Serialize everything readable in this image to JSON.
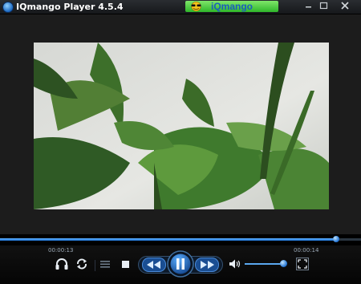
{
  "window": {
    "title": "IQmango Player 4.5.4",
    "brand_label": "iQmango"
  },
  "player": {
    "elapsed": "00:00:13",
    "total": "00:00:14",
    "progress_fraction": 0.93,
    "volume_fraction": 0.95
  },
  "icons": {
    "app": "app-logo-icon",
    "minimize": "minimize-icon",
    "maximize": "maximize-icon",
    "close": "close-icon",
    "headphones": "headphones-icon",
    "repeat": "repeat-icon",
    "playlist": "playlist-icon",
    "stop": "stop-icon",
    "rewind": "rewind-icon",
    "pause": "pause-icon",
    "fast_forward": "fast-forward-icon",
    "volume": "volume-icon",
    "fullscreen": "fullscreen-icon"
  },
  "colors": {
    "accent": "#1c73d6",
    "brand_green": "#2fb62a",
    "brand_text": "#1b5dbd"
  }
}
